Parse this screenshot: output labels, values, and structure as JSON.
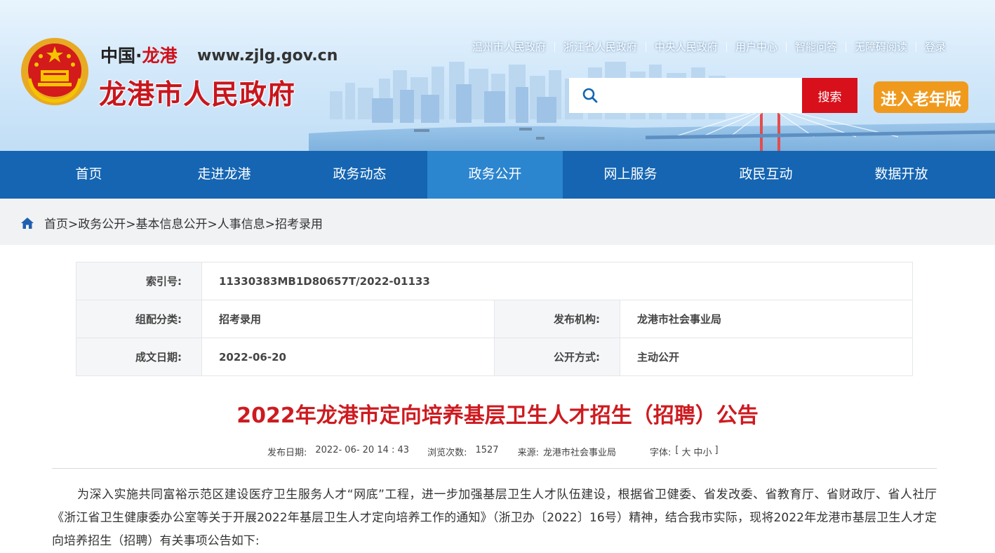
{
  "header": {
    "site_prefix": "中国·",
    "site_prefix_red": "龙港",
    "site_url": "www.zjlg.gov.cn",
    "site_title": "龙港市人民政府",
    "top_links": [
      "温州市人民政府",
      "浙江省人民政府",
      "中央人民政府",
      "用户中心",
      "智能问答",
      "无障碍阅读",
      "登录"
    ],
    "search": {
      "placeholder": "",
      "button_label": "搜索"
    },
    "elder_button": "进入老年版"
  },
  "nav": {
    "items": [
      "首页",
      "走进龙港",
      "政务动态",
      "政务公开",
      "网上服务",
      "政民互动",
      "数据开放"
    ],
    "active": "政务公开"
  },
  "breadcrumb": [
    "首页>",
    "政务公开>",
    "基本信息公开>",
    "人事信息>",
    "招考录用"
  ],
  "info_table": {
    "index_label": "索引号:",
    "index_value": "11330383MB1D80657T/2022-01133",
    "category_label": "组配分类:",
    "category_value": "招考录用",
    "publisher_label": "发布机构:",
    "publisher_value": "龙港市社会事业局",
    "date_label": "成文日期:",
    "date_value": "2022-06-20",
    "open_label": "公开方式:",
    "open_value": "主动公开"
  },
  "article": {
    "title": "2022年龙港市定向培养基层卫生人才招生（招聘）公告",
    "meta": {
      "publish_label": "发布日期:",
      "publish_value": "2022- 06- 20 14 : 43",
      "views_label": "浏览次数:",
      "views_value": "1527",
      "source_label": "来源:",
      "source_value": "龙港市社会事业局",
      "font_label": "字体:",
      "font_open": "[",
      "font_large": "大",
      "font_medium": "中",
      "font_small": "小",
      "font_close": "]"
    },
    "paragraph": "为深入实施共同富裕示范区建设医疗卫生服务人才“网底”工程，进一步加强基层卫生人才队伍建设，根据省卫健委、省发改委、省教育厅、省财政厅、省人社厅《浙江省卫生健康委办公室等关于开展2022年基层卫生人才定向培养工作的通知》（浙卫办〔2022〕16号）精神，结合我市实际，现将2022年龙港市基层卫生人才定向培养招生（招聘）有关事项公告如下:"
  },
  "colors": {
    "nav_bg": "#1565b2",
    "nav_active": "#2c85cf",
    "title_red": "#cd1b20",
    "search_btn": "#d8101b",
    "elder_btn": "#f09a1d"
  },
  "icons": [
    "national-emblem-icon",
    "search-icon",
    "home-icon"
  ]
}
